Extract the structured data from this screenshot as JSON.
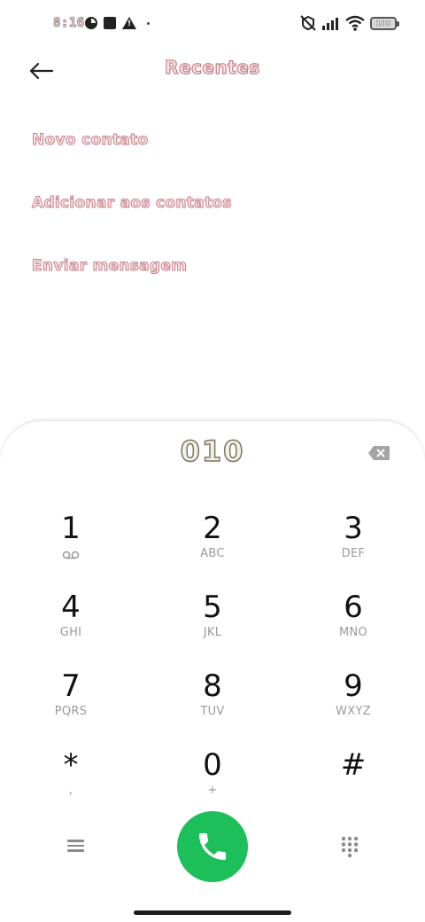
{
  "status_bar": {
    "time": "8:16",
    "battery": "100",
    "icons": [
      "pie-chart-icon",
      "square-app-icon",
      "warning-icon",
      "dot-icon",
      "vibrate-off-icon",
      "signal-icon",
      "wifi-icon",
      "battery-icon"
    ]
  },
  "header": {
    "title": "Recentes",
    "back_icon": "arrow-left-icon"
  },
  "options": [
    {
      "label": "Novo contato"
    },
    {
      "label": "Adicionar aos contatos"
    },
    {
      "label": "Enviar mensagem"
    }
  ],
  "dialer": {
    "number": "010",
    "backspace_icon": "backspace-icon",
    "keys": [
      {
        "digit": "1",
        "letters": ""
      },
      {
        "digit": "2",
        "letters": "ABC"
      },
      {
        "digit": "3",
        "letters": "DEF"
      },
      {
        "digit": "4",
        "letters": "GHI"
      },
      {
        "digit": "5",
        "letters": "JKL"
      },
      {
        "digit": "6",
        "letters": "MNO"
      },
      {
        "digit": "7",
        "letters": "PQRS"
      },
      {
        "digit": "8",
        "letters": "TUV"
      },
      {
        "digit": "9",
        "letters": "WXYZ"
      },
      {
        "digit": "*",
        "letters": ","
      },
      {
        "digit": "0",
        "letters": "+"
      },
      {
        "digit": "#",
        "letters": ""
      }
    ],
    "menu_icon": "menu-icon",
    "call_icon": "phone-icon",
    "keypad_icon": "dialpad-icon",
    "call_color": "#1dbf5a"
  }
}
